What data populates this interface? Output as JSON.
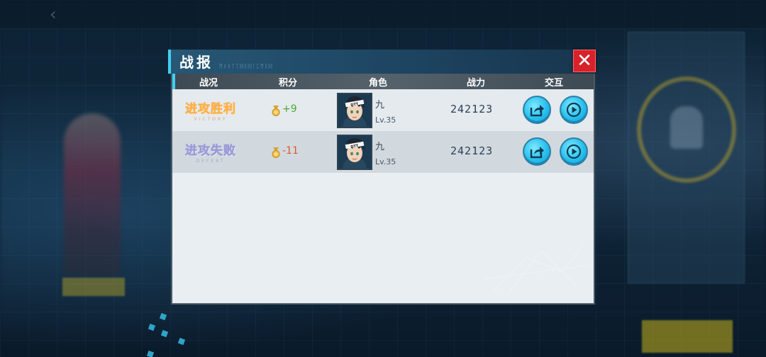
{
  "dialog": {
    "title": "战报",
    "title_deco": "ᛗᛟᚱᛏᛏᛞᚱᛞᛚᛈᛗᚱᛞ",
    "close_label": "✕"
  },
  "columns": {
    "status": "战况",
    "score": "积分",
    "character": "角色",
    "power": "战力",
    "interact": "交互"
  },
  "rows": [
    {
      "result": "进攻胜利",
      "result_sub": "VICTORY",
      "outcome": "win",
      "score": "+9",
      "name": "九",
      "level": "Lv.35",
      "power": "242123"
    },
    {
      "result": "进攻失败",
      "result_sub": "DEFEAT",
      "outcome": "lose",
      "score": "-11",
      "name": "九",
      "level": "Lv.35",
      "power": "242123"
    }
  ],
  "icons": {
    "close": "close-icon",
    "medal": "medal-icon",
    "share": "share-icon",
    "replay": "play-icon"
  },
  "colors": {
    "accent": "#3fd0ef",
    "close": "#d8222a",
    "win": "#ffb24a",
    "lose": "#9e9bd8",
    "score_plus": "#4ea832",
    "score_minus": "#e0562a"
  }
}
